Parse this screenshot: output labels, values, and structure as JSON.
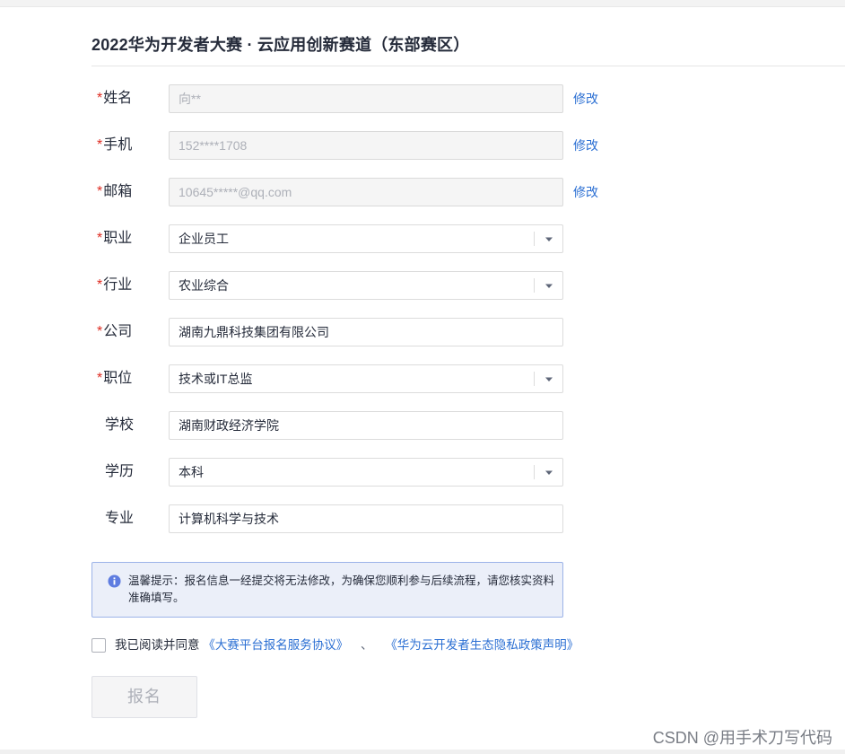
{
  "page": {
    "title": "2022华为开发者大赛 · 云应用创新赛道（东部赛区）"
  },
  "form": {
    "required_mark": "*",
    "edit_label": "修改",
    "name": {
      "label": "姓名",
      "value": "向**"
    },
    "phone": {
      "label": "手机",
      "value": "152****1708"
    },
    "email": {
      "label": "邮箱",
      "value": "10645*****@qq.com"
    },
    "occupation": {
      "label": "职业",
      "value": "企业员工"
    },
    "industry": {
      "label": "行业",
      "value": "农业综合"
    },
    "company": {
      "label": "公司",
      "value": "湖南九鼎科技集团有限公司"
    },
    "position": {
      "label": "职位",
      "value": "技术或IT总监"
    },
    "school": {
      "label": "学校",
      "value": "湖南财政经济学院"
    },
    "education": {
      "label": "学历",
      "value": "本科"
    },
    "major": {
      "label": "专业",
      "value": "计算机科学与技术"
    }
  },
  "notice": {
    "text": "温馨提示：报名信息一经提交将无法修改，为确保您顺利参与后续流程，请您核实资料准确填写。",
    "icon": "info-circle-icon"
  },
  "agreement": {
    "checked": false,
    "prefix": "我已阅读并同意",
    "link1": "《大赛平台报名服务协议》",
    "separator": "、",
    "link2": "《华为云开发者生态隐私政策声明》"
  },
  "submit": {
    "label": "报名"
  },
  "watermark": "CSDN @用手术刀写代码",
  "colors": {
    "accent_link": "#2b6fd3",
    "required": "#de2c22",
    "notice_bg": "#ebeff9",
    "notice_border": "#9cb3e8",
    "info_icon": "#5e7ce0"
  }
}
